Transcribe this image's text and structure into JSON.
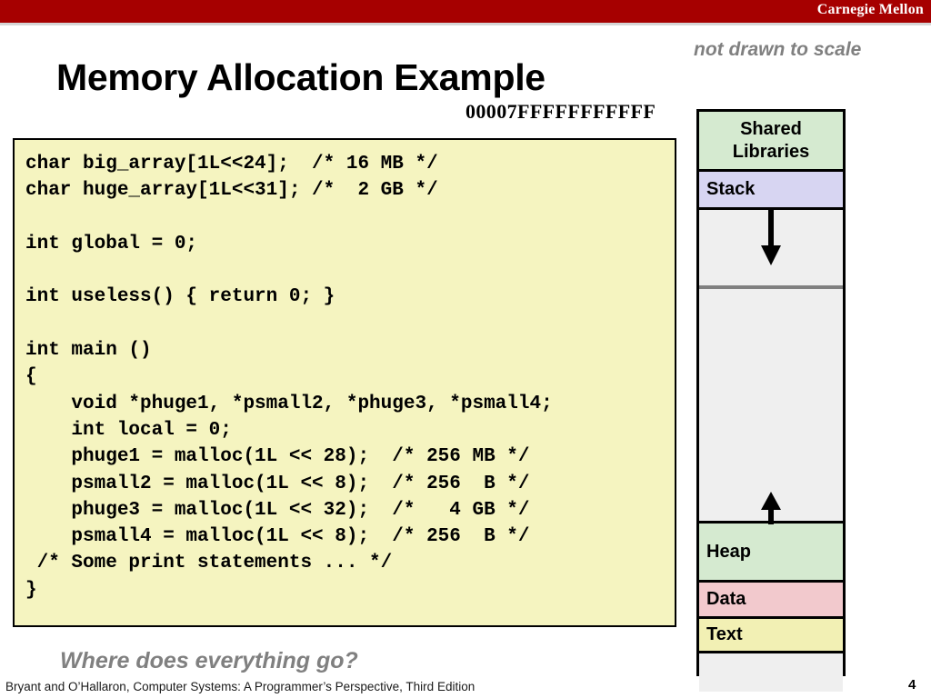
{
  "banner": {
    "brand": "Carnegie Mellon",
    "color": "#a60000"
  },
  "slide": {
    "title": "Memory Allocation Example",
    "note": "not drawn to scale",
    "hex_address": "00007FFFFFFFFFFF",
    "question": "Where does everything go?",
    "footer": "Bryant and O’Hallaron, Computer Systems: A Programmer’s Perspective, Third Edition",
    "page_number": "4"
  },
  "code": {
    "language": "c",
    "background": "#f5f4c0",
    "text": "char big_array[1L<<24];  /* 16 MB */\nchar huge_array[1L<<31]; /*  2 GB */\n\nint global = 0;\n\nint useless() { return 0; }\n\nint main ()\n{\n    void *phuge1, *psmall2, *phuge3, *psmall4;\n    int local = 0;\n    phuge1 = malloc(1L << 28);  /* 256 MB */\n    psmall2 = malloc(1L << 8);  /* 256  B */\n    phuge3 = malloc(1L << 32);  /*   4 GB */\n    psmall4 = malloc(1L << 8);  /* 256  B */\n /* Some print statements ... */\n}",
    "lines": [
      "char big_array[1L<<24];  /* 16 MB */",
      "char huge_array[1L<<31]; /*  2 GB */",
      "",
      "int global = 0;",
      "",
      "int useless() { return 0; }",
      "",
      "int main ()",
      "{",
      "    void *phuge1, *psmall2, *phuge3, *psmall4;",
      "    int local = 0;",
      "    phuge1 = malloc(1L << 28);  /* 256 MB */",
      "    psmall2 = malloc(1L << 8);  /* 256  B */",
      "    phuge3 = malloc(1L << 32);  /*   4 GB */",
      "    psmall4 = malloc(1L << 8);  /* 256  B */",
      " /* Some print statements ... */",
      "}"
    ]
  },
  "memory_diagram": {
    "segments": [
      {
        "name": "shared-libraries",
        "label": "Shared Libraries",
        "label_line1": "Shared",
        "label_line2": "Libraries",
        "color": "#d5ead0",
        "align": "center"
      },
      {
        "name": "stack",
        "label": "Stack",
        "color": "#d7d5f2",
        "align": "left"
      },
      {
        "name": "gap-upper",
        "label": "",
        "color": "#efefef",
        "align": "left"
      },
      {
        "name": "gap-lower",
        "label": "",
        "color": "#efefef",
        "align": "left"
      },
      {
        "name": "heap",
        "label": "Heap",
        "color": "#d5ead0",
        "align": "left"
      },
      {
        "name": "data",
        "label": "Data",
        "color": "#f2c9cd",
        "align": "left"
      },
      {
        "name": "text",
        "label": "Text",
        "color": "#f2f0b4",
        "align": "left"
      },
      {
        "name": "bottom-blank",
        "label": "",
        "color": "#efefef",
        "align": "left"
      }
    ],
    "arrows": [
      {
        "name": "stack-grow-arrow",
        "direction": "down"
      },
      {
        "name": "heap-grow-arrow",
        "direction": "up"
      }
    ]
  }
}
